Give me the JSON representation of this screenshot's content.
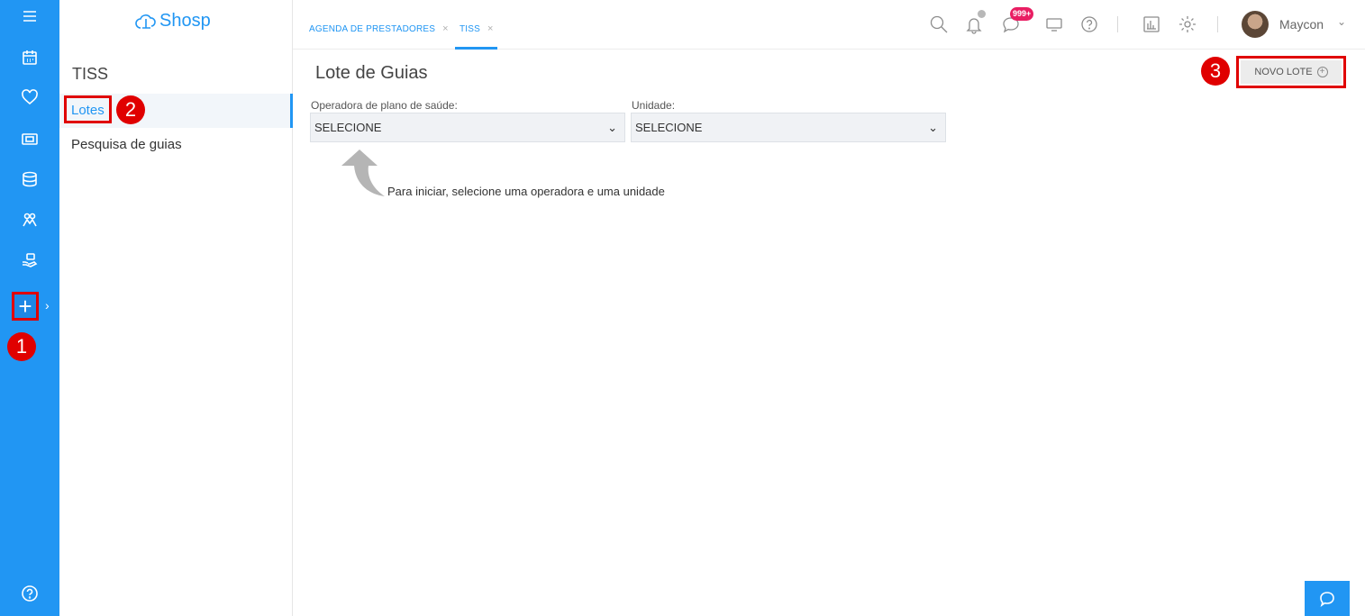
{
  "app": {
    "logo_text": "Shosp"
  },
  "tabs": [
    {
      "label": "AGENDA DE PRESTADORES",
      "close": "×"
    },
    {
      "label": "TISS",
      "close": "×"
    }
  ],
  "header": {
    "notification_count": "999+",
    "user_name": "Maycon"
  },
  "subnav": {
    "title": "TISS",
    "items": [
      {
        "label": "Lotes"
      },
      {
        "label": "Pesquisa de guias"
      }
    ]
  },
  "main": {
    "title": "Lote de Guias",
    "new_batch_button": "NOVO LOTE",
    "operator_label": "Operadora de plano de saúde:",
    "operator_value": "SELECIONE",
    "unit_label": "Unidade:",
    "unit_value": "SELECIONE",
    "hint": "Para iniciar, selecione uma operadora e uma unidade"
  },
  "annotations": [
    "1",
    "2",
    "3"
  ],
  "colors": {
    "primary": "#2196f3",
    "annotation": "#e00000",
    "badge": "#e91e63"
  },
  "icons": [
    "menu-icon",
    "calendar-icon",
    "heart-icon",
    "money-icon",
    "database-icon",
    "users-icon",
    "hand-icon",
    "plus-icon",
    "help-icon",
    "search-icon",
    "bell-icon",
    "chat-icon",
    "monitor-icon",
    "question-icon",
    "report-icon",
    "gear-icon",
    "chat-bubble-icon"
  ]
}
